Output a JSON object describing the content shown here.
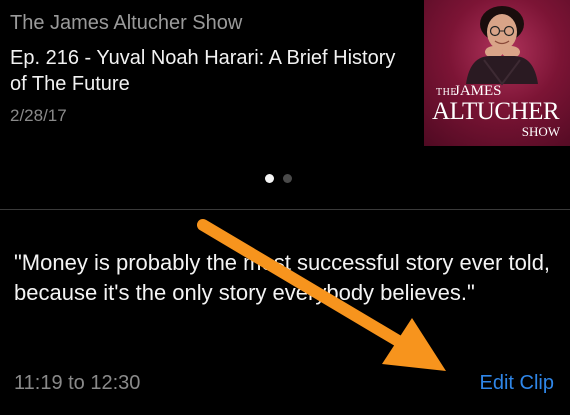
{
  "episode": {
    "show_title": "The James Altucher Show",
    "title": "Ep. 216 - Yuval Noah Harari: A Brief History of The Future",
    "date": "2/28/17"
  },
  "artwork": {
    "line_the": "THE",
    "line_james": "JAMES",
    "line_altucher": "ALTUCHER",
    "line_show": "SHOW",
    "background_color": "#7c1435"
  },
  "pager": {
    "count": 2,
    "active_index": 0
  },
  "clip": {
    "quote": "\"Money is probably the most successful story ever told, because it's the only story everybody believes.\"",
    "time_range": "11:19 to 12:30",
    "edit_label": "Edit Clip"
  },
  "colors": {
    "accent": "#2f86e8",
    "annotation_arrow": "#f7941d",
    "background": "#000000"
  }
}
